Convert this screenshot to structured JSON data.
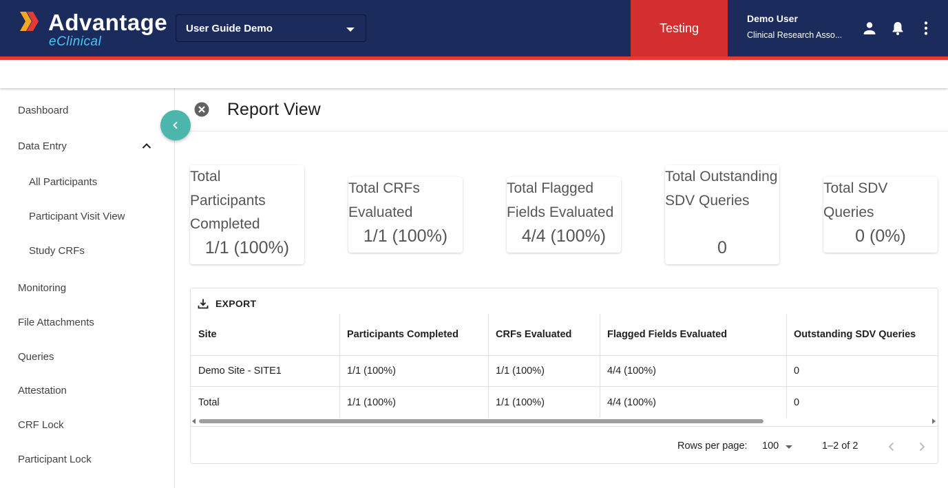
{
  "header": {
    "logo_main": "Advantage",
    "logo_sub": "eClinical",
    "study_select": "User Guide Demo",
    "environment": "Testing",
    "user_name": "Demo User",
    "user_role": "Clinical Research Asso...",
    "icons": [
      "account-icon",
      "bell-icon",
      "more-vert-icon"
    ],
    "colors": {
      "bar": "#1b2b5c",
      "environment": "#d32f2f",
      "accent_line": "#e53935",
      "logo_sub": "#4fc3f7"
    }
  },
  "sidebar": {
    "items": [
      {
        "label": "Dashboard"
      },
      {
        "label": "Data Entry",
        "expanded": true
      },
      {
        "label": "All Participants",
        "sub": true
      },
      {
        "label": "Participant Visit View",
        "sub": true
      },
      {
        "label": "Study CRFs",
        "sub": true
      },
      {
        "label": "Monitoring"
      },
      {
        "label": "File Attachments"
      },
      {
        "label": "Queries"
      },
      {
        "label": "Attestation"
      },
      {
        "label": "CRF Lock"
      },
      {
        "label": "Participant Lock"
      }
    ],
    "collapse_color": "#4db6ac"
  },
  "main": {
    "title": "Report View",
    "cards": [
      {
        "label": "Total Participants Completed",
        "value": "1/1 (100%)"
      },
      {
        "label": "Total CRFs Evaluated",
        "value": "1/1 (100%)"
      },
      {
        "label": "Total Flagged Fields Evaluated",
        "value": "4/4 (100%)"
      },
      {
        "label": "Total Outstanding SDV Queries",
        "value": "0"
      },
      {
        "label": "Total SDV Queries",
        "value": "0 (0%)"
      }
    ],
    "export_label": "EXPORT",
    "table": {
      "columns": [
        "Site",
        "Participants Completed",
        "CRFs Evaluated",
        "Flagged Fields Evaluated",
        "Outstanding SDV Queries"
      ],
      "rows": [
        [
          "Demo Site - SITE1",
          "1/1 (100%)",
          "1/1 (100%)",
          "4/4 (100%)",
          "0"
        ],
        [
          "Total",
          "1/1 (100%)",
          "1/1 (100%)",
          "4/4 (100%)",
          "0"
        ]
      ]
    },
    "pagination": {
      "rows_per_page_label": "Rows per page:",
      "rows_per_page": "100",
      "range": "1–2 of 2"
    }
  }
}
